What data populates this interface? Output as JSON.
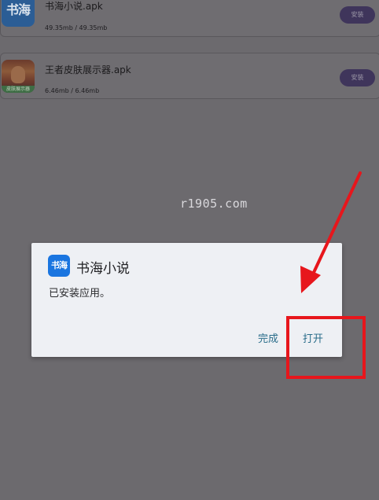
{
  "downloads": [
    {
      "name": "书海小说.apk",
      "size": "49.35mb / 49.35mb",
      "action": "安装",
      "icon_text": "书海",
      "icon": "shuhai-app-icon"
    },
    {
      "name": "王者皮肤展示器.apk",
      "size": "6.46mb / 6.46mb",
      "action": "安装",
      "icon_text": "皮肤展示器",
      "icon": "game-character-app-icon"
    }
  ],
  "watermark": "r1905.com",
  "dialog": {
    "icon_text": "书海",
    "title": "书海小说",
    "message": "已安装应用。",
    "done_label": "完成",
    "open_label": "打开"
  },
  "annotations": {
    "arrow": "red-arrow-icon",
    "highlight": "red-highlight-box",
    "color": "#e7161c"
  },
  "colors": {
    "background_dim": "#6c6a6e",
    "dialog_bg": "#eef0f4",
    "dialog_button": "#2a6d8a",
    "install_button": "#3f355b",
    "dialog_icon": "#1a75e0"
  }
}
